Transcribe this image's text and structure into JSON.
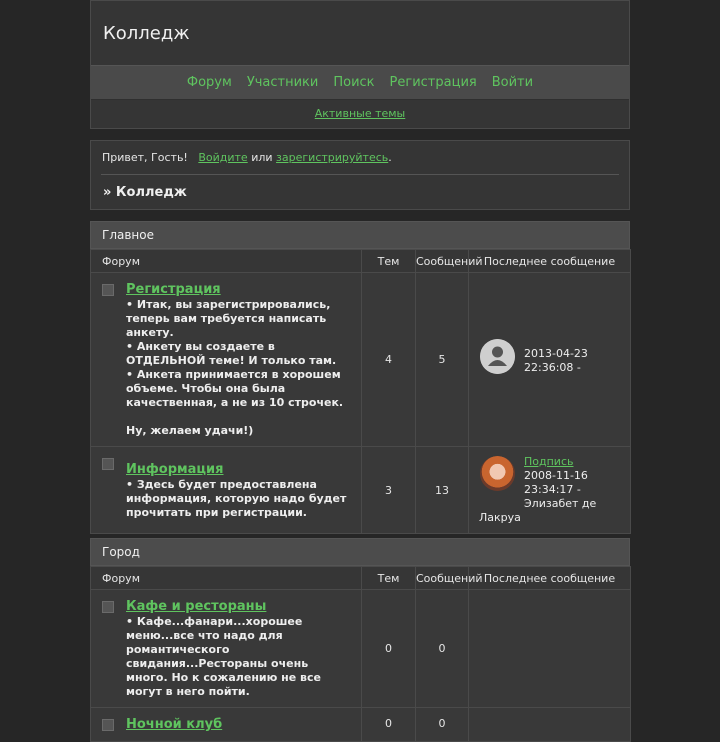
{
  "header": {
    "site_title": "Колледж",
    "nav": [
      "Форум",
      "Участники",
      "Поиск",
      "Регистрация",
      "Войти"
    ],
    "active_topics": "Активные темы"
  },
  "welcome": {
    "greeting": "Привет, Гость!",
    "login": "Войдите",
    "or": "или",
    "register": "зарегистрируйтесь",
    "dot": ".",
    "breadcrumb": "» Колледж"
  },
  "columns": {
    "forum": "Форум",
    "topics": "Тем",
    "posts": "Сообщений",
    "last": "Последнее сообщение"
  },
  "categories": [
    {
      "name": "Главное",
      "forums": [
        {
          "title": "Регистрация",
          "desc": "• Итак, вы зарегистрировались, теперь вам требуется написать анкету.\n• Анкету вы создаете в ОТДЕЛЬНОЙ теме! И только там.\n• Анкета принимается в хорошем объеме. Чтобы она была качественная, а не из 10 строчек.\n\nНу, желаем удачи!)",
          "topics": "4",
          "posts": "5",
          "last_date": "2013-04-23 22:36:08 -",
          "avatar": "default-avatar-icon"
        },
        {
          "title": "Информация",
          "desc": "• Здесь будет предоставлена информация, которую надо будет прочитать при регистрации.",
          "topics": "3",
          "posts": "13",
          "last_topic": "Подпись",
          "last_date": "2008-11-16 23:34:17 -",
          "last_author_a": "Элизабет де",
          "last_author_b": "Лакруа",
          "avatar": "user-photo-avatar"
        }
      ]
    },
    {
      "name": "Город",
      "forums": [
        {
          "title": "Кафе и рестораны",
          "desc": "• Кафе...фанари...хорошее меню...все что надо для романтического свидания...Рестораны очень много. Но к сожалению не все могут в него пойти.",
          "topics": "0",
          "posts": "0"
        },
        {
          "title": "Ночной клуб",
          "topics": "0",
          "posts": "0"
        }
      ]
    }
  ]
}
